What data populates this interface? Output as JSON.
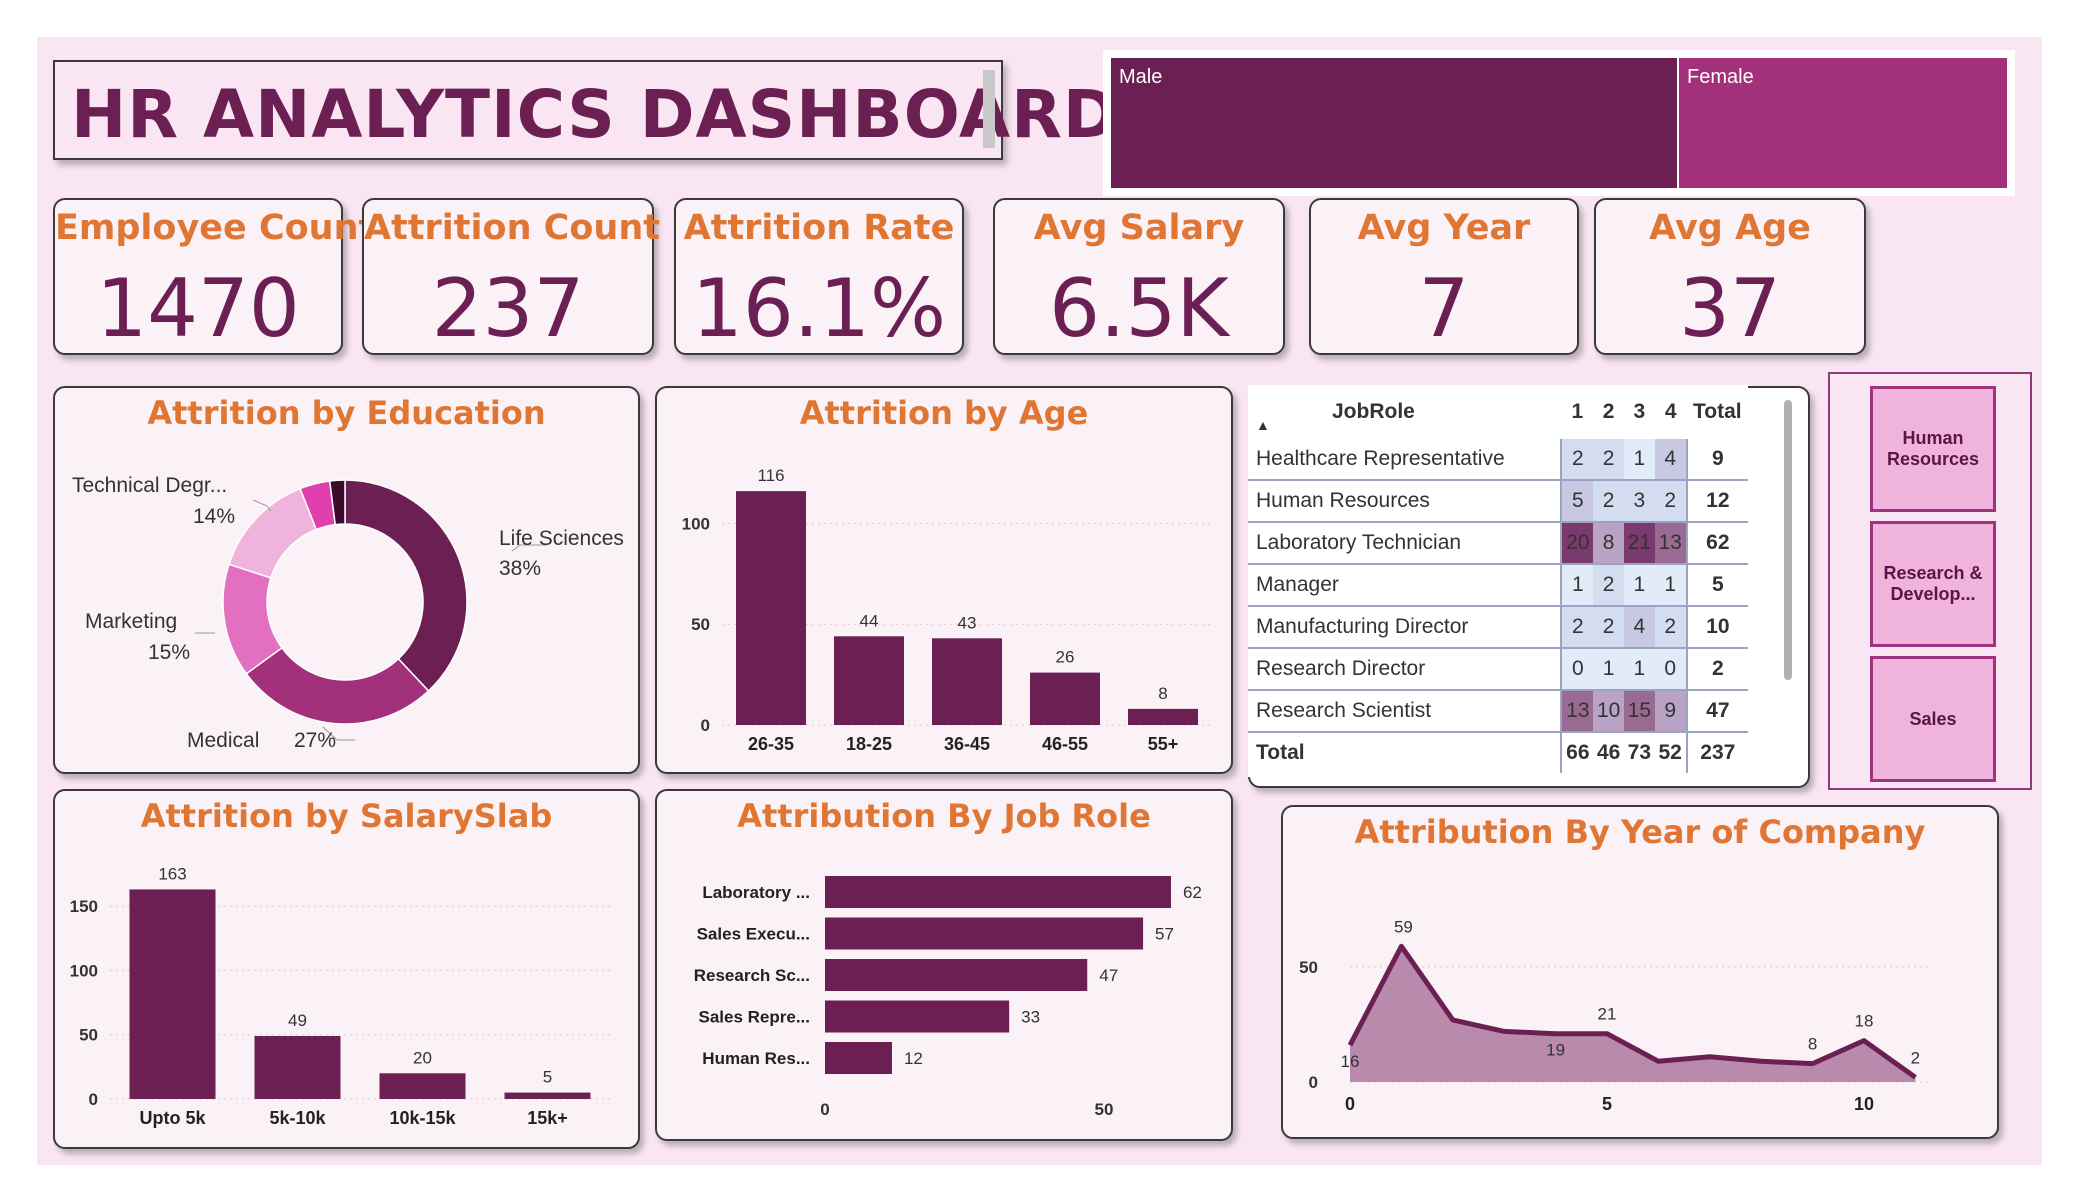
{
  "title": "HR ANALYTICS DASHBOARD",
  "gender": [
    {
      "label": "Male",
      "color": "#6b1f52"
    },
    {
      "label": "Female",
      "color": "#a3307a"
    }
  ],
  "kpis": [
    {
      "label": "Employee Count",
      "value": "1470"
    },
    {
      "label": "Attrition Count",
      "value": "237"
    },
    {
      "label": "Attrition Rate",
      "value": "16.1%"
    },
    {
      "label": "Avg Salary",
      "value": "6.5K"
    },
    {
      "label": "Avg Year",
      "value": "7"
    },
    {
      "label": "Avg Age",
      "value": "37"
    }
  ],
  "colors": {
    "primary": "#6b1f52",
    "accent": "#e07634",
    "background": "#f9e6f2",
    "card": "#fbf2f8"
  },
  "chart_data": [
    {
      "type": "pie",
      "title": "Attrition by Education",
      "slices": [
        {
          "label": "Life Sciences",
          "pct": "38%",
          "value": 38,
          "color": "#6b1f52"
        },
        {
          "label": "Medical",
          "pct": "27%",
          "value": 27,
          "color": "#a3307a"
        },
        {
          "label": "Marketing",
          "pct": "15%",
          "value": 15,
          "color": "#e36fc0"
        },
        {
          "label": "Technical Degr...",
          "pct": "14%",
          "value": 14,
          "color": "#f0b3dc"
        },
        {
          "label": "",
          "pct": "",
          "value": 4,
          "color": "#e13fae"
        },
        {
          "label": "",
          "pct": "",
          "value": 2,
          "color": "#3d0a2c"
        }
      ]
    },
    {
      "type": "bar",
      "title": "Attrition by Age",
      "categories": [
        "26-35",
        "18-25",
        "36-45",
        "46-55",
        "55+"
      ],
      "values": [
        116,
        44,
        43,
        26,
        8
      ],
      "yticks": [
        "0",
        "50",
        "100"
      ],
      "ylim": [
        0,
        125
      ]
    },
    {
      "type": "table",
      "headers": [
        "JobRole",
        "1",
        "2",
        "3",
        "4",
        "Total"
      ],
      "rows": [
        {
          "role": "Healthcare Representative",
          "v": [
            "2",
            "2",
            "1",
            "4"
          ],
          "total": "9"
        },
        {
          "role": "Human Resources",
          "v": [
            "5",
            "2",
            "3",
            "2"
          ],
          "total": "12"
        },
        {
          "role": "Laboratory Technician",
          "v": [
            "20",
            "8",
            "21",
            "13"
          ],
          "total": "62"
        },
        {
          "role": "Manager",
          "v": [
            "1",
            "2",
            "1",
            "1"
          ],
          "total": "5"
        },
        {
          "role": "Manufacturing Director",
          "v": [
            "2",
            "2",
            "4",
            "2"
          ],
          "total": "10"
        },
        {
          "role": "Research Director",
          "v": [
            "0",
            "1",
            "1",
            "0"
          ],
          "total": "2"
        },
        {
          "role": "Research Scientist",
          "v": [
            "13",
            "10",
            "15",
            "9"
          ],
          "total": "47"
        }
      ],
      "total_row": {
        "role": "Total",
        "v": [
          "66",
          "46",
          "73",
          "52"
        ],
        "total": "237"
      }
    },
    {
      "type": "bar",
      "title": "Attrition by SalarySlab",
      "categories": [
        "Upto 5k",
        "5k-10k",
        "10k-15k",
        "15k+"
      ],
      "values": [
        163,
        49,
        20,
        5
      ],
      "yticks": [
        "0",
        "50",
        "100",
        "150"
      ],
      "ylim": [
        0,
        175
      ]
    },
    {
      "type": "bar",
      "title": "Attribution By Job Role",
      "categories": [
        "Laboratory ...",
        "Sales Execu...",
        "Research Sc...",
        "Sales Repre...",
        "Human Res..."
      ],
      "values": [
        62,
        57,
        47,
        33,
        12
      ],
      "xticks": [
        "0",
        "50"
      ],
      "xlim": [
        0,
        67
      ]
    },
    {
      "type": "area",
      "title": "Attribution By Year of Company",
      "x": [
        0,
        1,
        2,
        3,
        4,
        5,
        6,
        7,
        8,
        9,
        10,
        11
      ],
      "values": [
        16,
        59,
        27,
        22,
        21,
        21,
        9,
        11,
        9,
        8,
        18,
        2
      ],
      "labels": [
        "16",
        "59",
        "",
        "",
        "19",
        "21",
        "",
        "",
        "",
        "8",
        "18",
        "2"
      ],
      "xticks": [
        "0",
        "5",
        "10"
      ],
      "yticks": [
        "0",
        "50"
      ],
      "ylim": [
        0,
        65
      ]
    }
  ],
  "slicer": [
    "Human Resources",
    "Research & Develop...",
    "Sales"
  ]
}
